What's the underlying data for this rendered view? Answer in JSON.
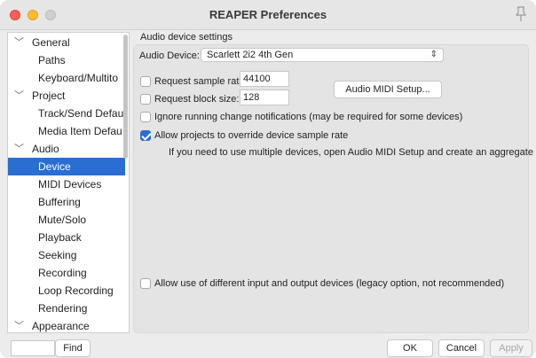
{
  "window": {
    "title": "REAPER Preferences"
  },
  "sidebar": {
    "items": [
      {
        "label": "General",
        "expandable": true,
        "indent": 0
      },
      {
        "label": "Paths",
        "indent": 1
      },
      {
        "label": "Keyboard/Multito",
        "indent": 1
      },
      {
        "label": "Project",
        "expandable": true,
        "indent": 0
      },
      {
        "label": "Track/Send Defau",
        "indent": 1
      },
      {
        "label": "Media Item Defau",
        "indent": 1
      },
      {
        "label": "Audio",
        "expandable": true,
        "indent": 0
      },
      {
        "label": "Device",
        "indent": 1,
        "selected": true
      },
      {
        "label": "MIDI Devices",
        "indent": 1
      },
      {
        "label": "Buffering",
        "indent": 1
      },
      {
        "label": "Mute/Solo",
        "indent": 1
      },
      {
        "label": "Playback",
        "indent": 1
      },
      {
        "label": "Seeking",
        "indent": 1
      },
      {
        "label": "Recording",
        "indent": 1
      },
      {
        "label": "Loop Recording",
        "indent": 1
      },
      {
        "label": "Rendering",
        "indent": 1
      },
      {
        "label": "Appearance",
        "expandable": true,
        "indent": 0
      }
    ]
  },
  "content": {
    "section_title": "Audio device settings",
    "audio_device_label": "Audio Device:",
    "audio_device_value": "Scarlett 2i2 4th Gen",
    "request_sample_rate_label": "Request sample rate:",
    "request_sample_rate_value": "44100",
    "request_block_size_label": "Request block size:",
    "request_block_size_value": "128",
    "audio_midi_setup_button": "Audio MIDI Setup...",
    "ignore_notifications_label": "Ignore running change notifications (may be required for some devices)",
    "allow_override_label": "Allow projects to override device sample rate",
    "multiple_devices_note": "If you need to use multiple devices, open Audio MIDI Setup and create an aggregate device.",
    "different_io_label": "Allow use of different input and output devices (legacy option, not recommended)"
  },
  "footer": {
    "find_button": "Find",
    "ok_button": "OK",
    "cancel_button": "Cancel",
    "apply_button": "Apply"
  },
  "colors": {
    "selection": "#2a6ed2",
    "close": "#ff5f57",
    "minimize": "#febc2e"
  }
}
